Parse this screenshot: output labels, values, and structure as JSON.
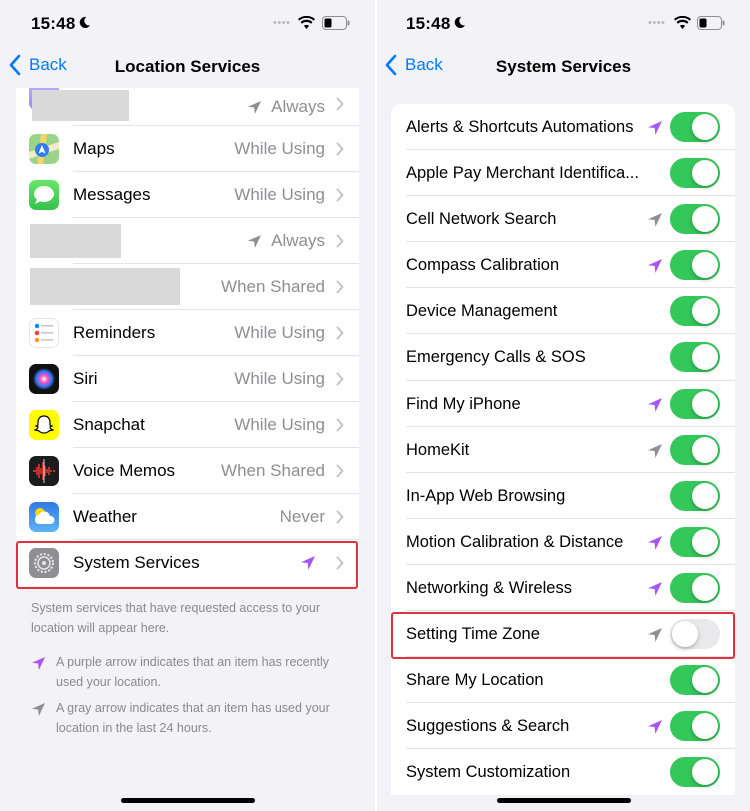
{
  "colors": {
    "accent": "#007aff",
    "purple_arrow": "#a855f7",
    "gray_arrow": "#8e8e93",
    "toggle_on": "#34c759",
    "highlight": "#e0313f"
  },
  "left_screen": {
    "status_bar": {
      "time": "15:48"
    },
    "nav": {
      "back_label": "Back",
      "title": "Location Services"
    },
    "apps": [
      {
        "name": "",
        "status": "Always",
        "icon": "redacted-app-icon",
        "arrow": "gray"
      },
      {
        "name": "Maps",
        "status": "While Using",
        "icon": "maps-icon"
      },
      {
        "name": "Messages",
        "status": "While Using",
        "icon": "messages-icon"
      },
      {
        "name": "",
        "status": "Always",
        "icon": "redacted-app-icon",
        "arrow": "gray"
      },
      {
        "name": "",
        "status": "When Shared",
        "icon": "redacted-app-icon"
      },
      {
        "name": "Reminders",
        "status": "While Using",
        "icon": "reminders-icon"
      },
      {
        "name": "Siri",
        "status": "While Using",
        "icon": "siri-icon"
      },
      {
        "name": "Snapchat",
        "status": "While Using",
        "icon": "snapchat-icon"
      },
      {
        "name": "Voice Memos",
        "status": "When Shared",
        "icon": "voice-memos-icon"
      },
      {
        "name": "Weather",
        "status": "Never",
        "icon": "weather-icon"
      },
      {
        "name": "System Services",
        "status": "",
        "icon": "settings-gear-icon",
        "arrow": "purple"
      }
    ],
    "footnote": "System services that have requested access to your location will appear here.",
    "legend_purple": "A purple arrow indicates that an item has recently used your location.",
    "legend_gray": "A gray arrow indicates that an item has used your location in the last 24 hours."
  },
  "right_screen": {
    "status_bar": {
      "time": "15:48"
    },
    "nav": {
      "back_label": "Back",
      "title": "System Services"
    },
    "services": [
      {
        "name": "Alerts & Shortcuts Automations",
        "arrow": "purple",
        "enabled": true
      },
      {
        "name": "Apple Pay Merchant Identifica...",
        "arrow": "none",
        "enabled": true
      },
      {
        "name": "Cell Network Search",
        "arrow": "gray",
        "enabled": true
      },
      {
        "name": "Compass Calibration",
        "arrow": "purple",
        "enabled": true
      },
      {
        "name": "Device Management",
        "arrow": "none",
        "enabled": true
      },
      {
        "name": "Emergency Calls & SOS",
        "arrow": "none",
        "enabled": true
      },
      {
        "name": "Find My iPhone",
        "arrow": "purple",
        "enabled": true
      },
      {
        "name": "HomeKit",
        "arrow": "gray",
        "enabled": true
      },
      {
        "name": "In-App Web Browsing",
        "arrow": "none",
        "enabled": true
      },
      {
        "name": "Motion Calibration & Distance",
        "arrow": "purple",
        "enabled": true
      },
      {
        "name": "Networking & Wireless",
        "arrow": "purple",
        "enabled": true
      },
      {
        "name": "Setting Time Zone",
        "arrow": "gray",
        "enabled": false
      },
      {
        "name": "Share My Location",
        "arrow": "none",
        "enabled": true
      },
      {
        "name": "Suggestions & Search",
        "arrow": "purple",
        "enabled": true
      },
      {
        "name": "System Customization",
        "arrow": "none",
        "enabled": true
      }
    ]
  }
}
